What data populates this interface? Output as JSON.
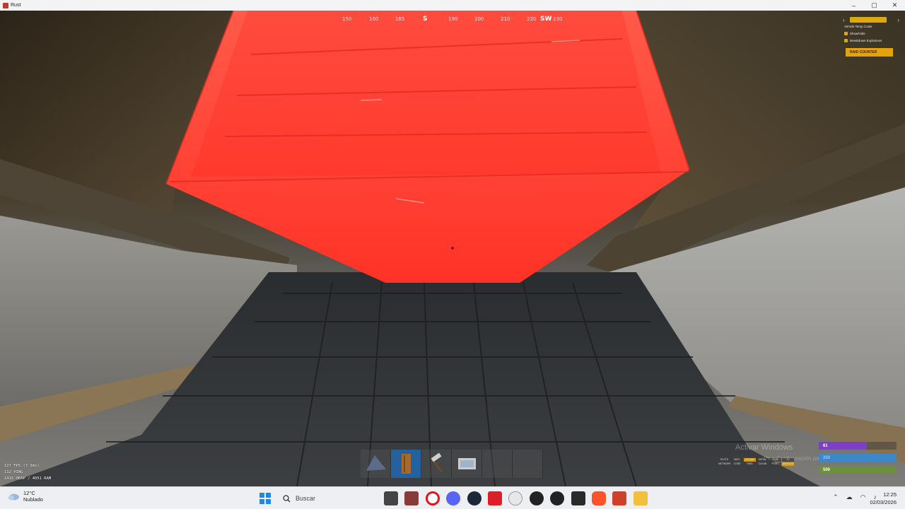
{
  "window": {
    "title": "Rust",
    "icon": "rust-app-icon",
    "controls": {
      "minimize": "–",
      "maximize": "▢",
      "close": "✕"
    }
  },
  "compass": {
    "ticks": [
      "150",
      "160",
      "165",
      "S",
      "190",
      "200",
      "210",
      "220",
      "SW",
      "230"
    ]
  },
  "right_panel": {
    "items": [
      "Vehicle Temp Costs",
      "Show/Hide",
      "Breakdown Explosives"
    ],
    "raid_button": "RAID COUNTER"
  },
  "stats": {
    "fps": "127 FPS (7.9ms)",
    "ping": "112 PING",
    "memory": "1415 HEAP / 4051 RAM"
  },
  "hotbar": {
    "slots": [
      {
        "item": "tarp-icon"
      },
      {
        "item": "wood-door-icon",
        "active": true
      },
      {
        "item": "hammer-icon"
      },
      {
        "item": "building-plan-icon"
      },
      {
        "item": "empty"
      },
      {
        "item": "empty"
      }
    ]
  },
  "vitals": {
    "health": "61",
    "health_fraction": 0.61,
    "water": "250",
    "food": "500"
  },
  "mini_buttons": [
    "SLOTS",
    "MISC",
    "STONE",
    "METAL",
    "HQM",
    "TC",
    "NETWORK",
    "CODE",
    "RAID",
    "CLEAN",
    "PORT",
    "ARMOUR"
  ],
  "watermark": "Activar Windows",
  "watermark_sub": "Ve a Configuración para activar Windows.",
  "taskbar": {
    "weather_temp": "12°C",
    "weather_desc": "Nublado",
    "search_placeholder": "Buscar",
    "apps": [
      "file-explorer",
      "winrar",
      "opera",
      "discord",
      "steam",
      "adobe",
      "chatgpt",
      "obs",
      "obs-2",
      "epic-games",
      "brave",
      "rust",
      "folders"
    ],
    "time": "12:25",
    "date": "02/03/2026"
  },
  "colors": {
    "highlight_red": "#ff3b2f",
    "accent_yellow": "#e6a309",
    "taskbar": "#eeeff2"
  }
}
